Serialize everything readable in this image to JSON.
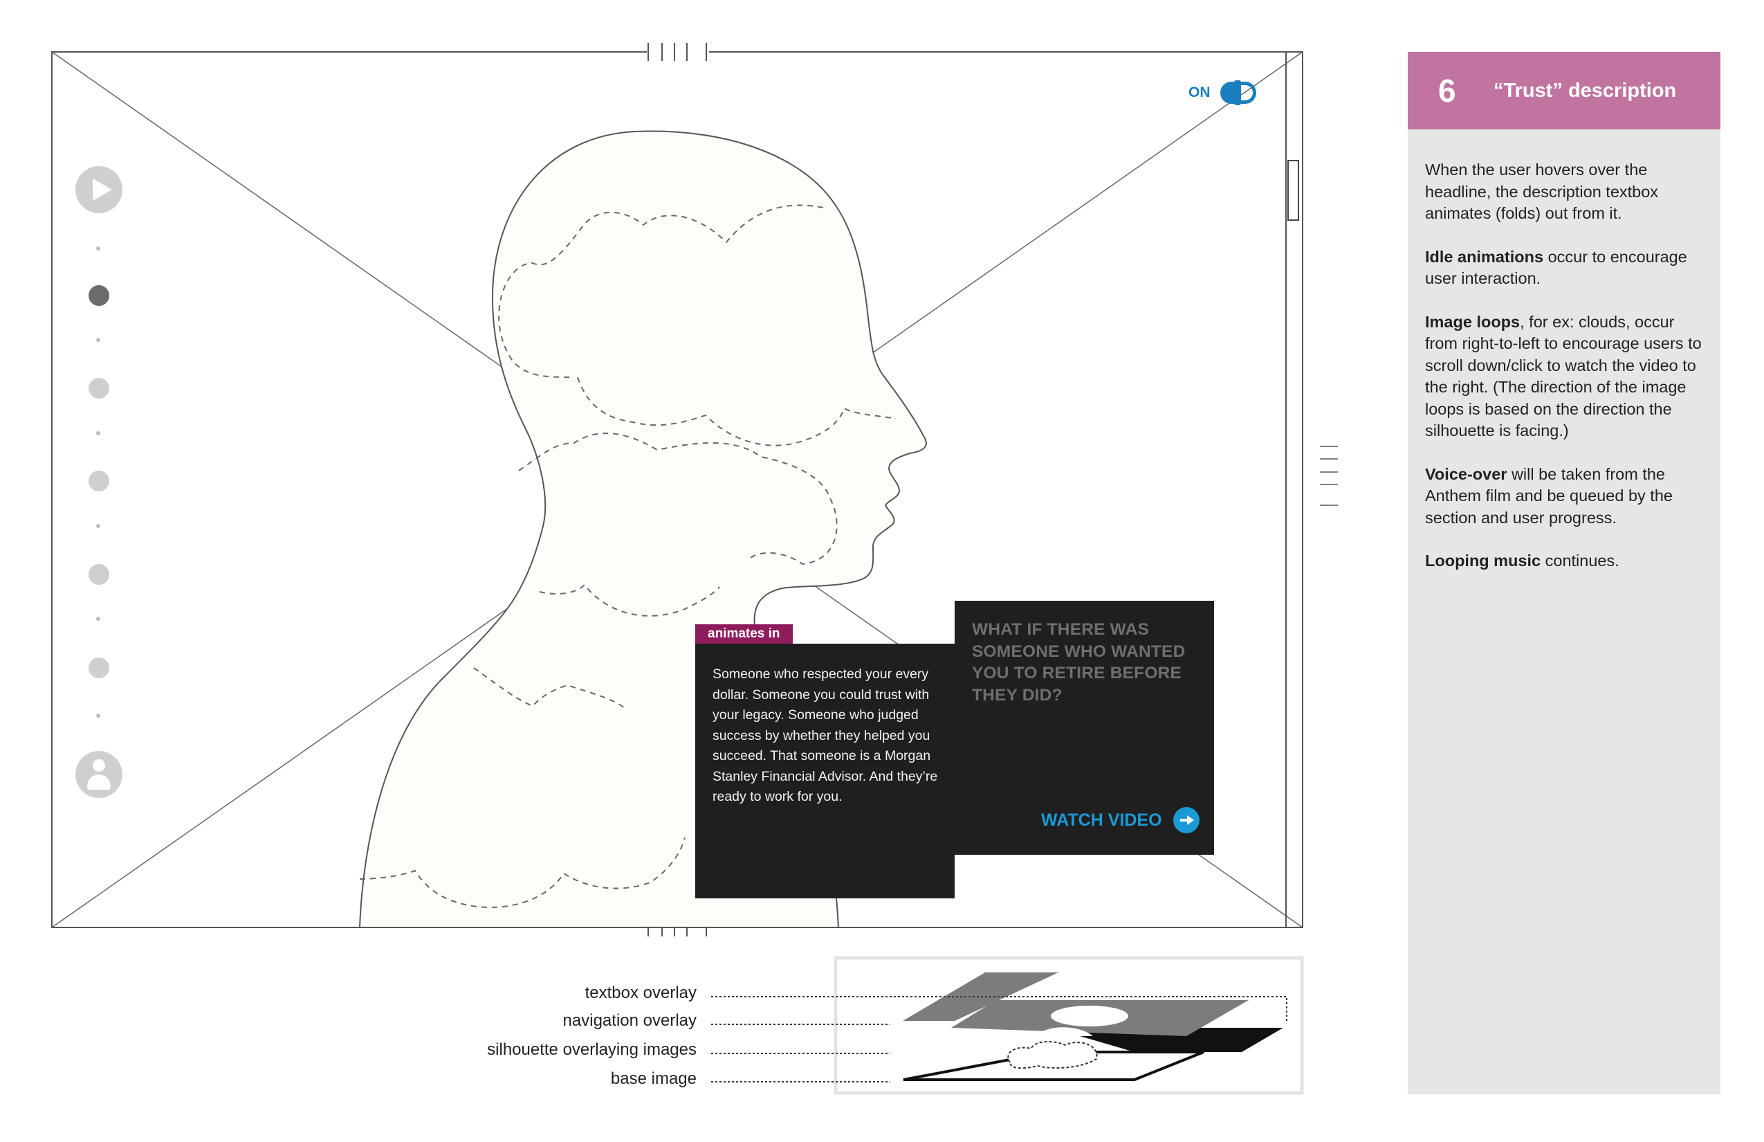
{
  "sound": {
    "label": "ON"
  },
  "textbox": {
    "tag": "animates in",
    "description": "Someone who respected your every dollar. Someone you could trust with your legacy. Someone who judged success by whether they helped you succeed. That someone is a Morgan Stanley Financial Advisor. And they’re ready to work for you.",
    "headline": "WHAT IF THERE WAS SOMEONE WHO WANTED YOU TO RETIRE BEFORE THEY DID?",
    "watch_label": "WATCH VIDEO"
  },
  "layers": {
    "textbox_overlay": "textbox overlay",
    "navigation_overlay": "navigation overlay",
    "silhouette_overlaying_images": "silhouette overlaying images",
    "base_image": "base image"
  },
  "panel": {
    "number": "6",
    "title": "“Trust” description",
    "p1": "When the user hovers over the headline, the description textbox animates (folds) out from it.",
    "p2_bold": "Idle animations",
    "p2_rest": " occur to encourage user interaction.",
    "p3_bold": "Image loops",
    "p3_rest": ", for ex: clouds, occur from right-to-left to encourage users to scroll down/click to watch the video to the right. (The direction of the image loops is based on the direction the silhouette is facing.)",
    "p4_bold": "Voice-over",
    "p4_rest": " will be taken from the Anthem film and be queued by the section and user progress.",
    "p5_bold": "Looping music",
    "p5_rest": " continues."
  },
  "icons": [
    "play-icon",
    "profile-icon",
    "sound-toggle-icon",
    "arrow-right-circle-icon",
    "mouse-cursor-icon"
  ],
  "colors": {
    "accent_blue": "#1a9ad6",
    "tag_magenta": "#8e1c5c",
    "panel_header": "#c0749f",
    "panel_bg": "#e6e6e6",
    "textbox_bg": "#1f1f1f"
  }
}
